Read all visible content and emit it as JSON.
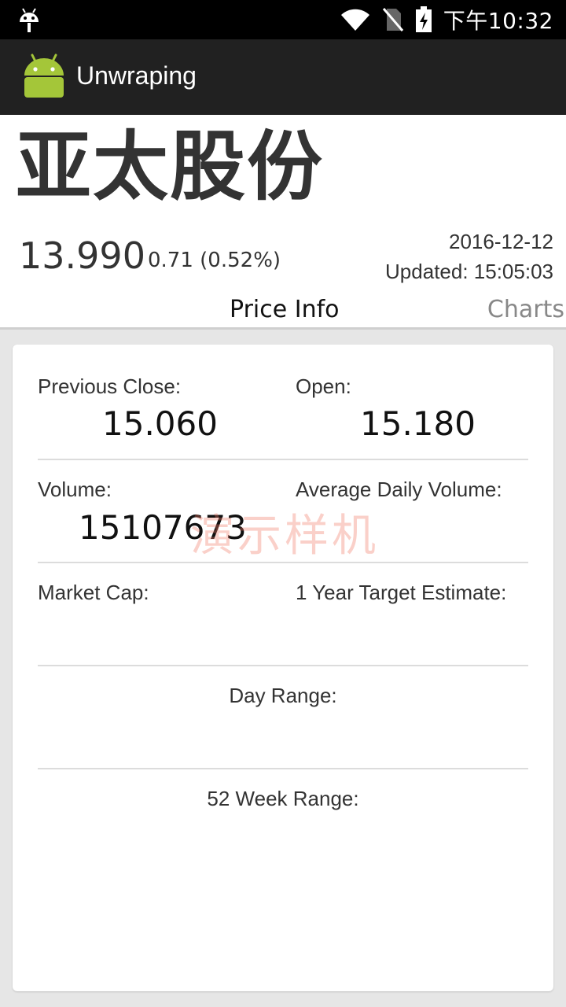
{
  "status_bar": {
    "time": "下午10:32",
    "icons": [
      "android-debug-icon",
      "wifi-icon",
      "no-sim-icon",
      "battery-charging-icon"
    ]
  },
  "app_bar": {
    "title": "Unwraping",
    "logo_icon": "android-logo-icon"
  },
  "stock": {
    "name": "亚太股份",
    "price": "13.990",
    "change": "0.71 (0.52%)",
    "date": "2016-12-12",
    "updated": "Updated: 15:05:03"
  },
  "tabs": [
    {
      "label": "Price Info",
      "active": true
    },
    {
      "label": "Charts",
      "active": false
    }
  ],
  "price_info": {
    "previous_close_label": "Previous Close:",
    "previous_close_value": "15.060",
    "open_label": "Open:",
    "open_value": "15.180",
    "volume_label": "Volume:",
    "volume_value": "15107673",
    "avg_volume_label": "Average Daily Volume:",
    "avg_volume_value": "",
    "market_cap_label": "Market Cap:",
    "market_cap_value": "",
    "target_label": "1 Year Target Estimate:",
    "target_value": "",
    "day_range_label": "Day Range:",
    "day_range_value": "",
    "week52_label": "52 Week Range:",
    "week52_value": ""
  },
  "watermark": "演示样机",
  "colors": {
    "app_bar": "#212121",
    "status_bar": "#000000",
    "android_green": "#a4c639",
    "background": "#e6e6e6"
  }
}
